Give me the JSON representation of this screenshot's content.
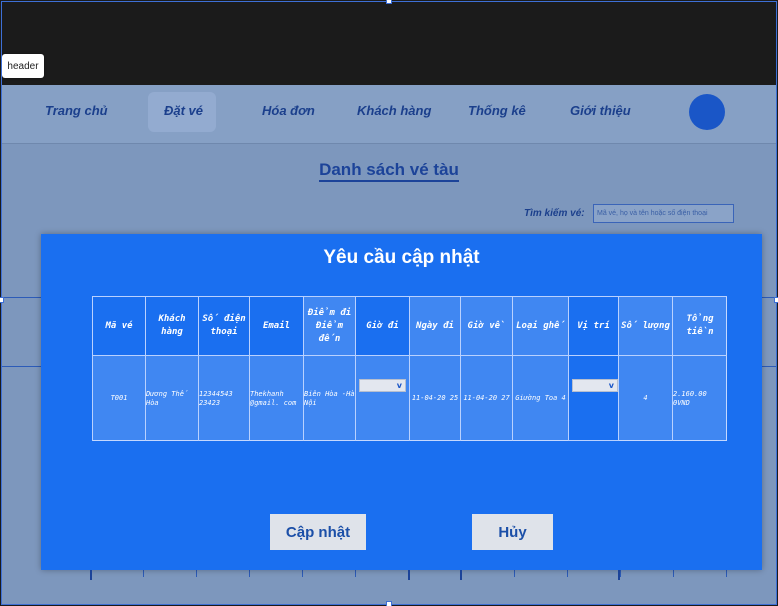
{
  "overlay": {
    "element_tag": "header"
  },
  "nav": {
    "items": [
      "Trang chủ",
      "Đặt vé",
      "Hóa đơn",
      "Khách hàng",
      "Thống kê",
      "Giới thiệu"
    ],
    "active_index": 1
  },
  "page": {
    "title": "Danh sách vé tàu",
    "search_label": "Tìm kiếm vé:",
    "search_placeholder": "Mã vé, họ và tên hoặc số điện thoại"
  },
  "modal": {
    "title": "Yêu cầu cập nhật",
    "columns": [
      "Mã vé",
      "Khách hàng",
      "Số điện thoại",
      "Email",
      "Điểm đi Điểm đến",
      "Giờ đi",
      "Ngày đi",
      "Giờ về",
      "Loại ghế",
      "Vị trí",
      "Số lượng",
      "Tổng tiền"
    ],
    "row": {
      "ma_ve": "T001",
      "khach_hang": "Dương Thế Hòa",
      "sdt": "12344543 23423",
      "email": "Thekhanh @gmail. com",
      "tuyen": "Biên Hòa -Hà Nội",
      "gio_di": "",
      "ngay_di": "11-04-20 25",
      "gio_ve": "11-04-20 27",
      "loai_ghe": "Giường Toa 4",
      "vi_tri": "",
      "so_luong": "4",
      "tong_tien": "2.160.00 0VND"
    },
    "dropdown_arrow": "v",
    "update_button": "Cập nhật",
    "cancel_button": "Hủy"
  },
  "colors": {
    "modal_bg": "#1a6ff0",
    "nav_text": "#1b3f8c",
    "button_bg": "#dfe3ea",
    "avatar": "#1a56c7"
  }
}
